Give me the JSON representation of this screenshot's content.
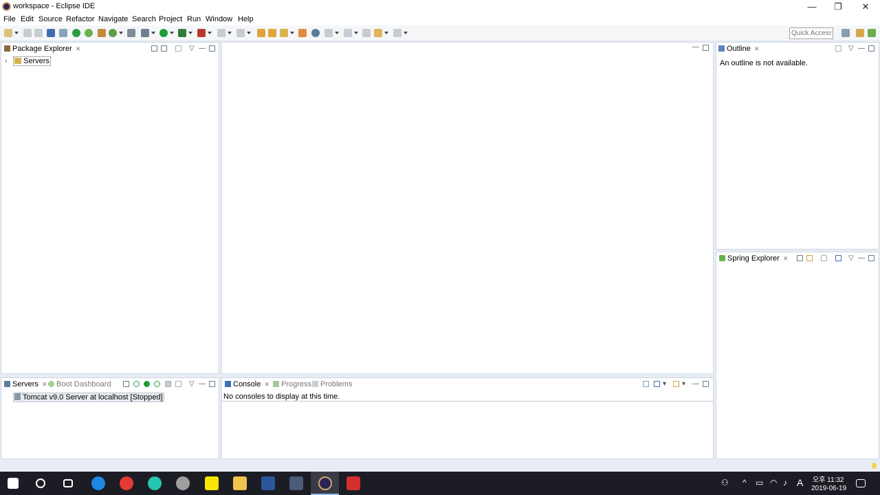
{
  "window": {
    "title": "workspace - Eclipse IDE",
    "minimize": "—",
    "maximize": "❐",
    "close": "✕"
  },
  "menu": [
    "File",
    "Edit",
    "Source",
    "Refactor",
    "Navigate",
    "Search",
    "Project",
    "Run",
    "Window",
    "Help"
  ],
  "quick_access": {
    "placeholder": "Quick Access"
  },
  "package_explorer": {
    "tab": "Package Explorer",
    "items": [
      {
        "label": "Servers",
        "expander": "›"
      }
    ]
  },
  "outline": {
    "tab": "Outline",
    "message": "An outline is not available."
  },
  "spring_explorer": {
    "tab": "Spring Explorer"
  },
  "servers": {
    "tabs": [
      "Servers",
      "Boot Dashboard"
    ],
    "items": [
      {
        "label": "Tomcat v9.0 Server at localhost  [Stopped]"
      }
    ]
  },
  "console": {
    "tabs": [
      "Console",
      "Progress",
      "Problems"
    ],
    "message": "No consoles to display at this time."
  },
  "taskbar": {
    "tray": {
      "ime": "A",
      "time": "오후 11:32",
      "date": "2019-06-19"
    }
  }
}
